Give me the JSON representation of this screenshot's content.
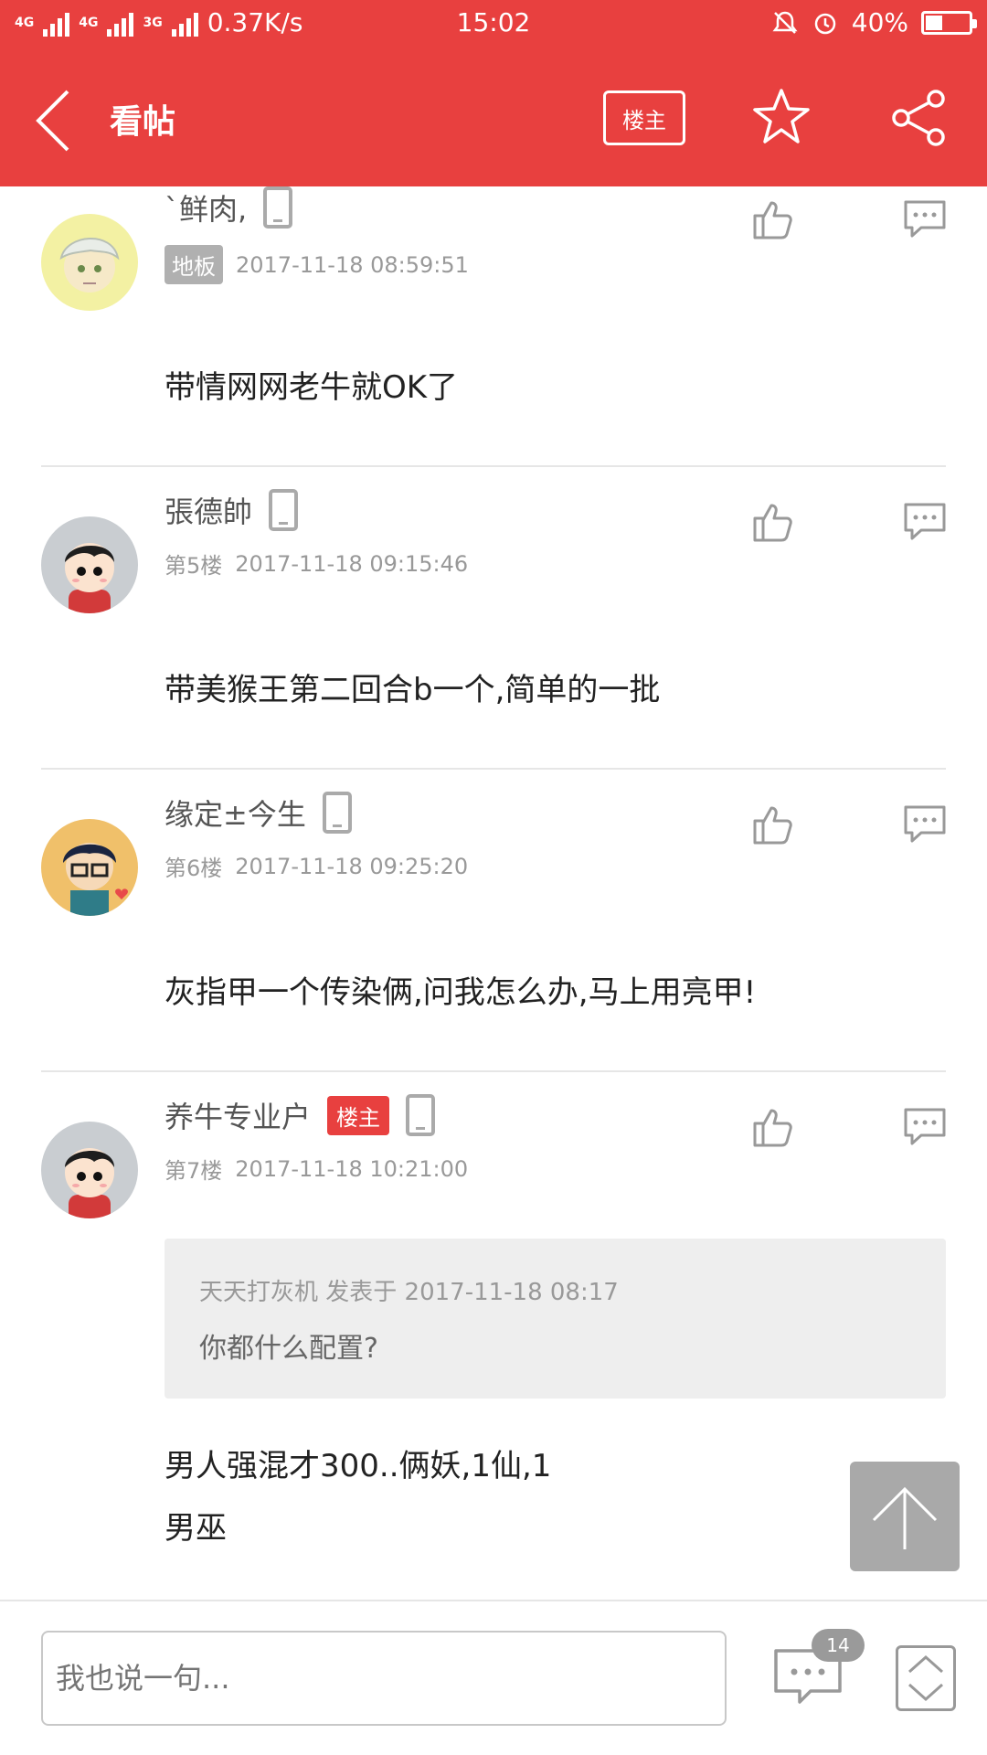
{
  "status_bar": {
    "network_1": "4G",
    "network_2": "4G",
    "network_3": "3G",
    "speed": "0.37K/s",
    "time": "15:02",
    "battery": "40%",
    "battery_level": 0.4
  },
  "header": {
    "title": "看帖",
    "owner_only_label": "楼主",
    "back_icon": "chevron-left-icon",
    "favorite_icon": "star-icon",
    "share_icon": "share-icon"
  },
  "posts": [
    {
      "username": "`鲜肉,",
      "floor": "地板",
      "time": "2017-11-18 08:59:51",
      "content": "带情网网老牛就OK了"
    },
    {
      "username": "張德帥",
      "floor": "第5楼",
      "time": "2017-11-18 09:15:46",
      "content": "带美猴王第二回合b一个,简单的一批"
    },
    {
      "username": "缘定±今生",
      "floor": "第6楼",
      "time": "2017-11-18 09:25:20",
      "content": "灰指甲一个传染俩,问我怎么办,马上用亮甲!"
    },
    {
      "username": "养牛专业户",
      "owner_tag": "楼主",
      "floor": "第7楼",
      "time": "2017-11-18 10:21:00",
      "quote_author": "天天打灰机 发表于 2017-11-18 08:17",
      "quote_text": "你都什么配置?",
      "content_line1": "男人强混才300..俩妖,1仙,1",
      "content_line2": "男巫"
    }
  ],
  "bottom_bar": {
    "input_placeholder": "我也说一句...",
    "comment_count": "14"
  },
  "colors": {
    "accent": "#e8403f",
    "floor_tag": "#b0b0b0",
    "icon_gray": "#999999"
  }
}
